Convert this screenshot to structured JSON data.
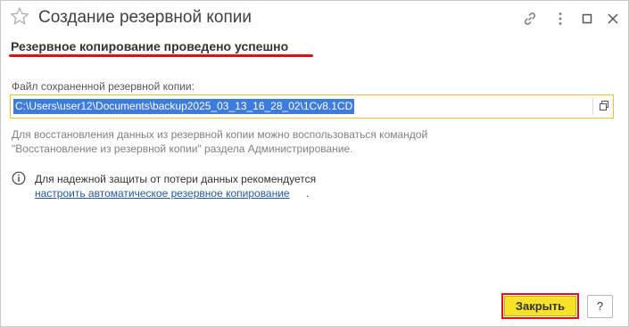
{
  "window": {
    "title": "Создание резервной копии",
    "icons": [
      "star-icon",
      "link-icon",
      "more-icon",
      "maximize-icon",
      "close-icon"
    ]
  },
  "heading": {
    "text": "Резервное копирование проведено успешно",
    "underline_color": "#e0101a"
  },
  "file_field": {
    "label": "Файл сохраненной резервной копии:",
    "value": "C:\\Users\\user12\\Documents\\backup2025_03_13_16_28_02\\1Cv8.1CD",
    "copy_icon": "copy-icon"
  },
  "description": {
    "line1": "Для восстановления данных из резервной копии можно воспользоваться командой",
    "line2": "\"Восстановление из резервной копии\" раздела Администрирование."
  },
  "info": {
    "icon": "info-icon",
    "text": "Для надежной защиты от потери данных рекомендуется",
    "link": "настроить автоматическое резервное копирование",
    "suffix": "."
  },
  "buttons": {
    "close_label": "Закрыть",
    "help_label": "?"
  },
  "colors": {
    "accent_yellow": "#f7e22a",
    "highlight_red": "#e0101a",
    "selection_blue": "#3d7bdc",
    "link_blue": "#2358a6"
  }
}
